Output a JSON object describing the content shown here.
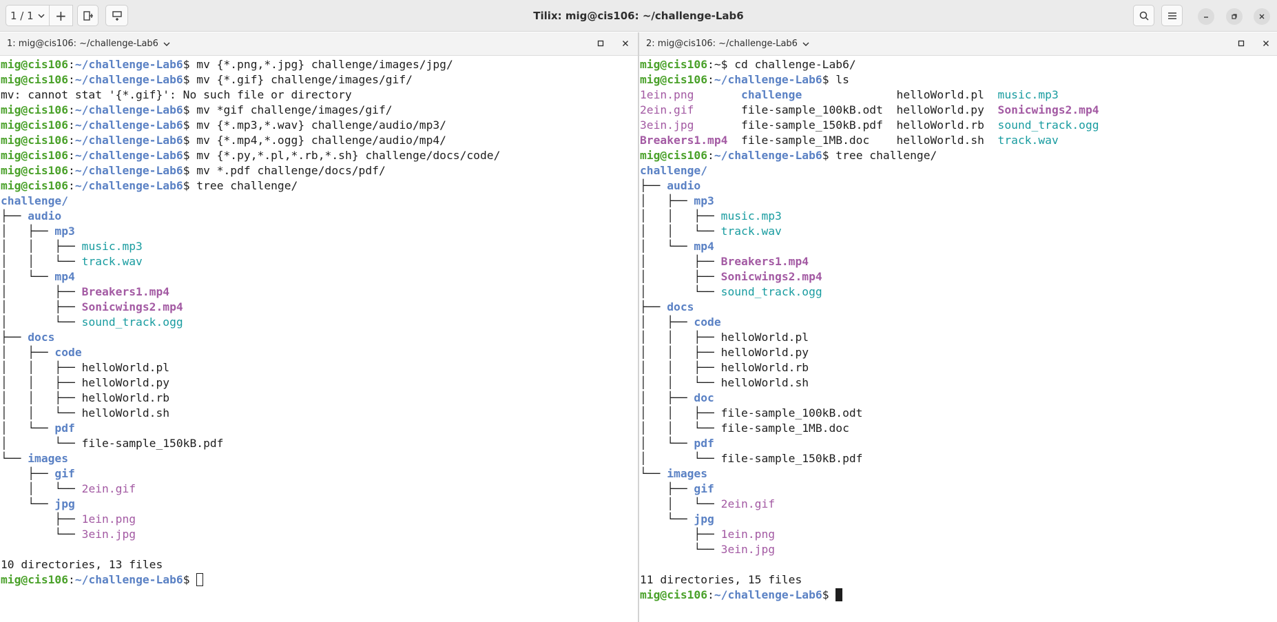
{
  "window": {
    "title": "Tilix: mig@cis106: ~/challenge-Lab6",
    "session_counter": "1 / 1",
    "add_label": "+",
    "colors": {
      "user": "#4aa12a",
      "dir": "#5a81c4",
      "media": "#a35aa3",
      "audio": "#199ca0"
    }
  },
  "panes": [
    {
      "title": "1: mig@cis106: ~/challenge-Lab6",
      "cursor": "outline",
      "lines": [
        [
          [
            "user",
            "mig@cis106"
          ],
          [
            "plain",
            ":"
          ],
          [
            "path",
            "~/challenge-Lab6"
          ],
          [
            "plain",
            "$ mv {*.png,*.jpg} challenge/images/jpg/"
          ]
        ],
        [
          [
            "user",
            "mig@cis106"
          ],
          [
            "plain",
            ":"
          ],
          [
            "path",
            "~/challenge-Lab6"
          ],
          [
            "plain",
            "$ mv {*.gif} challenge/images/gif/"
          ]
        ],
        [
          [
            "plain",
            "mv: cannot stat '{*.gif}': No such file or directory"
          ]
        ],
        [
          [
            "user",
            "mig@cis106"
          ],
          [
            "plain",
            ":"
          ],
          [
            "path",
            "~/challenge-Lab6"
          ],
          [
            "plain",
            "$ mv *gif challenge/images/gif/"
          ]
        ],
        [
          [
            "user",
            "mig@cis106"
          ],
          [
            "plain",
            ":"
          ],
          [
            "path",
            "~/challenge-Lab6"
          ],
          [
            "plain",
            "$ mv {*.mp3,*.wav} challenge/audio/mp3/"
          ]
        ],
        [
          [
            "user",
            "mig@cis106"
          ],
          [
            "plain",
            ":"
          ],
          [
            "path",
            "~/challenge-Lab6"
          ],
          [
            "plain",
            "$ mv {*.mp4,*.ogg} challenge/audio/mp4/"
          ]
        ],
        [
          [
            "user",
            "mig@cis106"
          ],
          [
            "plain",
            ":"
          ],
          [
            "path",
            "~/challenge-Lab6"
          ],
          [
            "plain",
            "$ mv {*.py,*.pl,*.rb,*.sh} challenge/docs/code/"
          ]
        ],
        [
          [
            "user",
            "mig@cis106"
          ],
          [
            "plain",
            ":"
          ],
          [
            "path",
            "~/challenge-Lab6"
          ],
          [
            "plain",
            "$ mv *.pdf challenge/docs/pdf/"
          ]
        ],
        [
          [
            "user",
            "mig@cis106"
          ],
          [
            "plain",
            ":"
          ],
          [
            "path",
            "~/challenge-Lab6"
          ],
          [
            "plain",
            "$ tree challenge/"
          ]
        ],
        [
          [
            "dir",
            "challenge/"
          ]
        ],
        [
          [
            "plain",
            "├── "
          ],
          [
            "dir",
            "audio"
          ]
        ],
        [
          [
            "plain",
            "│   ├── "
          ],
          [
            "dir",
            "mp3"
          ]
        ],
        [
          [
            "plain",
            "│   │   ├── "
          ],
          [
            "aud",
            "music.mp3"
          ]
        ],
        [
          [
            "plain",
            "│   │   └── "
          ],
          [
            "aud",
            "track.wav"
          ]
        ],
        [
          [
            "plain",
            "│   └── "
          ],
          [
            "dir",
            "mp4"
          ]
        ],
        [
          [
            "plain",
            "│       ├── "
          ],
          [
            "vid",
            "Breakers1.mp4"
          ]
        ],
        [
          [
            "plain",
            "│       ├── "
          ],
          [
            "vid",
            "Sonicwings2.mp4"
          ]
        ],
        [
          [
            "plain",
            "│       └── "
          ],
          [
            "aud",
            "sound_track.ogg"
          ]
        ],
        [
          [
            "plain",
            "├── "
          ],
          [
            "dir",
            "docs"
          ]
        ],
        [
          [
            "plain",
            "│   ├── "
          ],
          [
            "dir",
            "code"
          ]
        ],
        [
          [
            "plain",
            "│   │   ├── helloWorld.pl"
          ]
        ],
        [
          [
            "plain",
            "│   │   ├── helloWorld.py"
          ]
        ],
        [
          [
            "plain",
            "│   │   ├── helloWorld.rb"
          ]
        ],
        [
          [
            "plain",
            "│   │   └── helloWorld.sh"
          ]
        ],
        [
          [
            "plain",
            "│   └── "
          ],
          [
            "dir",
            "pdf"
          ]
        ],
        [
          [
            "plain",
            "│       └── file-sample_150kB.pdf"
          ]
        ],
        [
          [
            "plain",
            "└── "
          ],
          [
            "dir",
            "images"
          ]
        ],
        [
          [
            "plain",
            "    ├── "
          ],
          [
            "dir",
            "gif"
          ]
        ],
        [
          [
            "plain",
            "    │   └── "
          ],
          [
            "img",
            "2ein.gif"
          ]
        ],
        [
          [
            "plain",
            "    └── "
          ],
          [
            "dir",
            "jpg"
          ]
        ],
        [
          [
            "plain",
            "        ├── "
          ],
          [
            "img",
            "1ein.png"
          ]
        ],
        [
          [
            "plain",
            "        └── "
          ],
          [
            "img",
            "3ein.jpg"
          ]
        ],
        [
          [
            "plain",
            ""
          ]
        ],
        [
          [
            "plain",
            "10 directories, 13 files"
          ]
        ],
        [
          [
            "user",
            "mig@cis106"
          ],
          [
            "plain",
            ":"
          ],
          [
            "path",
            "~/challenge-Lab6"
          ],
          [
            "plain",
            "$ "
          ]
        ]
      ]
    },
    {
      "title": "2: mig@cis106: ~/challenge-Lab6",
      "cursor": "block",
      "lines": [
        [
          [
            "user",
            "mig@cis106"
          ],
          [
            "plain",
            ":~$ cd challenge-Lab6/"
          ]
        ],
        [
          [
            "user",
            "mig@cis106"
          ],
          [
            "plain",
            ":"
          ],
          [
            "path",
            "~/challenge-Lab6"
          ],
          [
            "plain",
            "$ ls"
          ]
        ],
        [
          [
            "img",
            "1ein.png"
          ],
          [
            "plain",
            "       "
          ],
          [
            "dir",
            "challenge"
          ],
          [
            "plain",
            "              helloWorld.pl  "
          ],
          [
            "aud",
            "music.mp3"
          ]
        ],
        [
          [
            "img",
            "2ein.gif"
          ],
          [
            "plain",
            "       file-sample_100kB.odt  helloWorld.py  "
          ],
          [
            "vid",
            "Sonicwings2.mp4"
          ]
        ],
        [
          [
            "img",
            "3ein.jpg"
          ],
          [
            "plain",
            "       file-sample_150kB.pdf  helloWorld.rb  "
          ],
          [
            "aud",
            "sound_track.ogg"
          ]
        ],
        [
          [
            "vid",
            "Breakers1.mp4"
          ],
          [
            "plain",
            "  file-sample_1MB.doc    helloWorld.sh  "
          ],
          [
            "aud",
            "track.wav"
          ]
        ],
        [
          [
            "user",
            "mig@cis106"
          ],
          [
            "plain",
            ":"
          ],
          [
            "path",
            "~/challenge-Lab6"
          ],
          [
            "plain",
            "$ tree challenge/"
          ]
        ],
        [
          [
            "dir",
            "challenge/"
          ]
        ],
        [
          [
            "plain",
            "├── "
          ],
          [
            "dir",
            "audio"
          ]
        ],
        [
          [
            "plain",
            "│   ├── "
          ],
          [
            "dir",
            "mp3"
          ]
        ],
        [
          [
            "plain",
            "│   │   ├── "
          ],
          [
            "aud",
            "music.mp3"
          ]
        ],
        [
          [
            "plain",
            "│   │   └── "
          ],
          [
            "aud",
            "track.wav"
          ]
        ],
        [
          [
            "plain",
            "│   └── "
          ],
          [
            "dir",
            "mp4"
          ]
        ],
        [
          [
            "plain",
            "│       ├── "
          ],
          [
            "vid",
            "Breakers1.mp4"
          ]
        ],
        [
          [
            "plain",
            "│       ├── "
          ],
          [
            "vid",
            "Sonicwings2.mp4"
          ]
        ],
        [
          [
            "plain",
            "│       └── "
          ],
          [
            "aud",
            "sound_track.ogg"
          ]
        ],
        [
          [
            "plain",
            "├── "
          ],
          [
            "dir",
            "docs"
          ]
        ],
        [
          [
            "plain",
            "│   ├── "
          ],
          [
            "dir",
            "code"
          ]
        ],
        [
          [
            "plain",
            "│   │   ├── helloWorld.pl"
          ]
        ],
        [
          [
            "plain",
            "│   │   ├── helloWorld.py"
          ]
        ],
        [
          [
            "plain",
            "│   │   ├── helloWorld.rb"
          ]
        ],
        [
          [
            "plain",
            "│   │   └── helloWorld.sh"
          ]
        ],
        [
          [
            "plain",
            "│   ├── "
          ],
          [
            "dir",
            "doc"
          ]
        ],
        [
          [
            "plain",
            "│   │   ├── file-sample_100kB.odt"
          ]
        ],
        [
          [
            "plain",
            "│   │   └── file-sample_1MB.doc"
          ]
        ],
        [
          [
            "plain",
            "│   └── "
          ],
          [
            "dir",
            "pdf"
          ]
        ],
        [
          [
            "plain",
            "│       └── file-sample_150kB.pdf"
          ]
        ],
        [
          [
            "plain",
            "└── "
          ],
          [
            "dir",
            "images"
          ]
        ],
        [
          [
            "plain",
            "    ├── "
          ],
          [
            "dir",
            "gif"
          ]
        ],
        [
          [
            "plain",
            "    │   └── "
          ],
          [
            "img",
            "2ein.gif"
          ]
        ],
        [
          [
            "plain",
            "    └── "
          ],
          [
            "dir",
            "jpg"
          ]
        ],
        [
          [
            "plain",
            "        ├── "
          ],
          [
            "img",
            "1ein.png"
          ]
        ],
        [
          [
            "plain",
            "        └── "
          ],
          [
            "img",
            "3ein.jpg"
          ]
        ],
        [
          [
            "plain",
            ""
          ]
        ],
        [
          [
            "plain",
            "11 directories, 15 files"
          ]
        ],
        [
          [
            "user",
            "mig@cis106"
          ],
          [
            "plain",
            ":"
          ],
          [
            "path",
            "~/challenge-Lab6"
          ],
          [
            "plain",
            "$ "
          ]
        ]
      ]
    }
  ]
}
